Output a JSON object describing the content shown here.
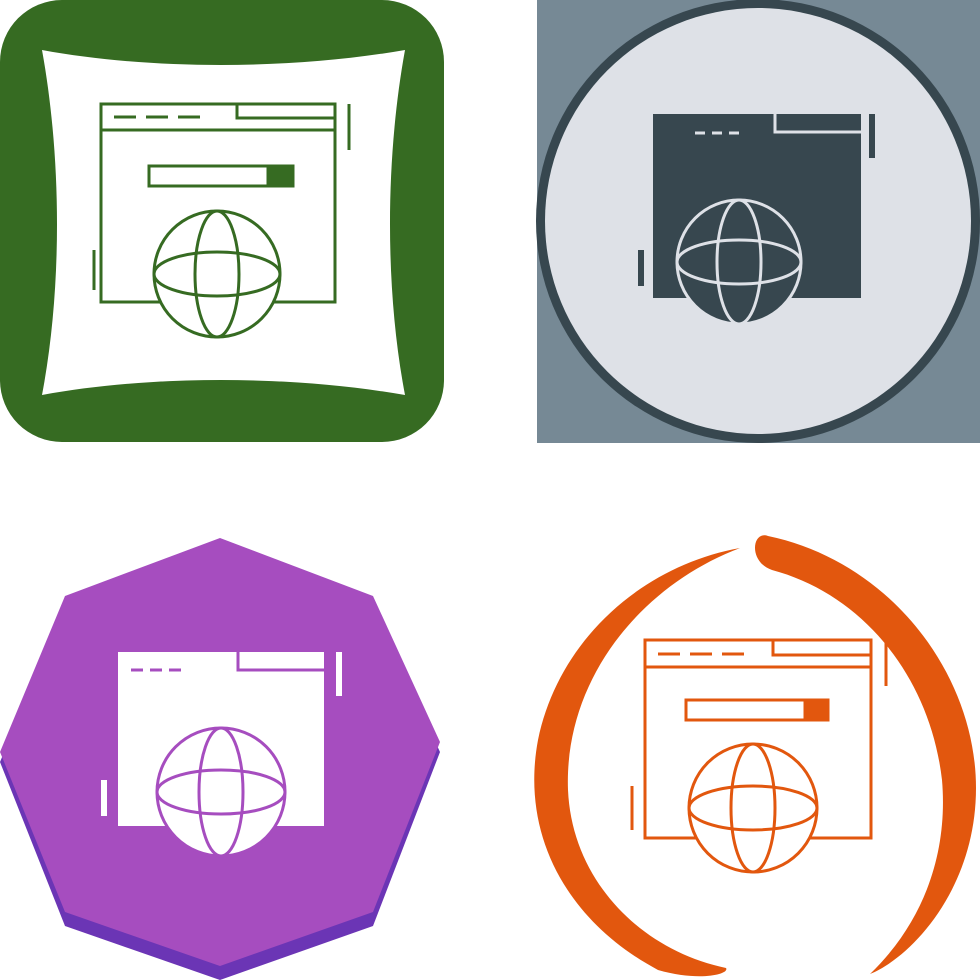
{
  "icons": [
    {
      "icon": "web-browser-globe-icon",
      "style": "line",
      "background_shape": "rounded-square-cushion",
      "colors": {
        "background": "#366b22",
        "inner": "#ffffff",
        "glyph": "#366b22"
      }
    },
    {
      "icon": "web-browser-globe-icon",
      "style": "glyph",
      "background_shape": "circle-on-square",
      "colors": {
        "background": "#768995",
        "ring": "#37474f",
        "disc": "#dee1e7",
        "glyph": "#37474f",
        "glyph_detail": "#dee1e7"
      }
    },
    {
      "icon": "web-browser-globe-icon",
      "style": "glyph",
      "background_shape": "heptagon",
      "colors": {
        "background": "#a64dbf",
        "shadow": "#6b35b5",
        "glyph": "#ffffff",
        "glyph_detail": "#a64dbf"
      }
    },
    {
      "icon": "web-browser-globe-icon",
      "style": "line",
      "background_shape": "circular-arrows",
      "colors": {
        "arrows": "#e2570e",
        "glyph": "#e2570e"
      }
    }
  ]
}
